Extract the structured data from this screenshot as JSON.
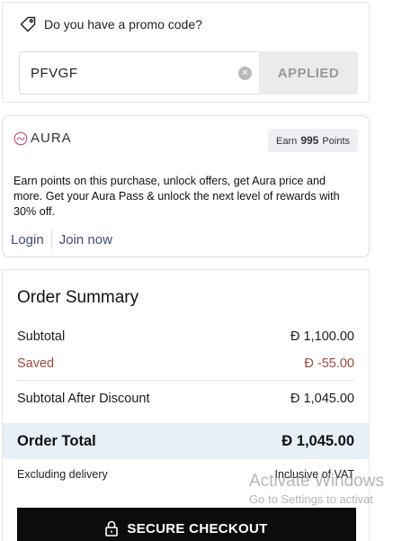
{
  "promo": {
    "heading": "Do you have a promo code?",
    "icon": "tag-icon",
    "code_value": "PFVGF",
    "clear_icon": "clear-icon",
    "apply_label": "APPLIED"
  },
  "aura": {
    "logo_text": "AURA",
    "earn_prefix": "Earn",
    "earn_points": "995",
    "earn_suffix": "Points",
    "description": "Earn points on this purchase, unlock offers, get Aura price and more. Get your Aura Pass & unlock the next level of rewards with 30% off.",
    "login_label": "Login",
    "join_label": "Join now"
  },
  "summary": {
    "title": "Order Summary",
    "subtotal_label": "Subtotal",
    "subtotal_value": "Ð 1,100.00",
    "saved_label": "Saved",
    "saved_value": "Ð -55.00",
    "after_discount_label": "Subtotal After Discount",
    "after_discount_value": "Ð 1,045.00",
    "total_label": "Order Total",
    "total_value": "Ð 1,045.00",
    "excluding_label": "Excluding delivery",
    "vat_label": "Inclusive of VAT",
    "checkout_label": "SECURE CHECKOUT",
    "checkout_icon": "lock-icon"
  },
  "watermark": {
    "line1": "Activate Windows",
    "line2": "Go to Settings to activat"
  },
  "colors": {
    "saved_red": "#a0493e",
    "link_blue": "#3e4d7f",
    "total_band": "#e7eff7",
    "checkout_bg": "#0c0c0c",
    "aura_logo": "#c0477f"
  }
}
